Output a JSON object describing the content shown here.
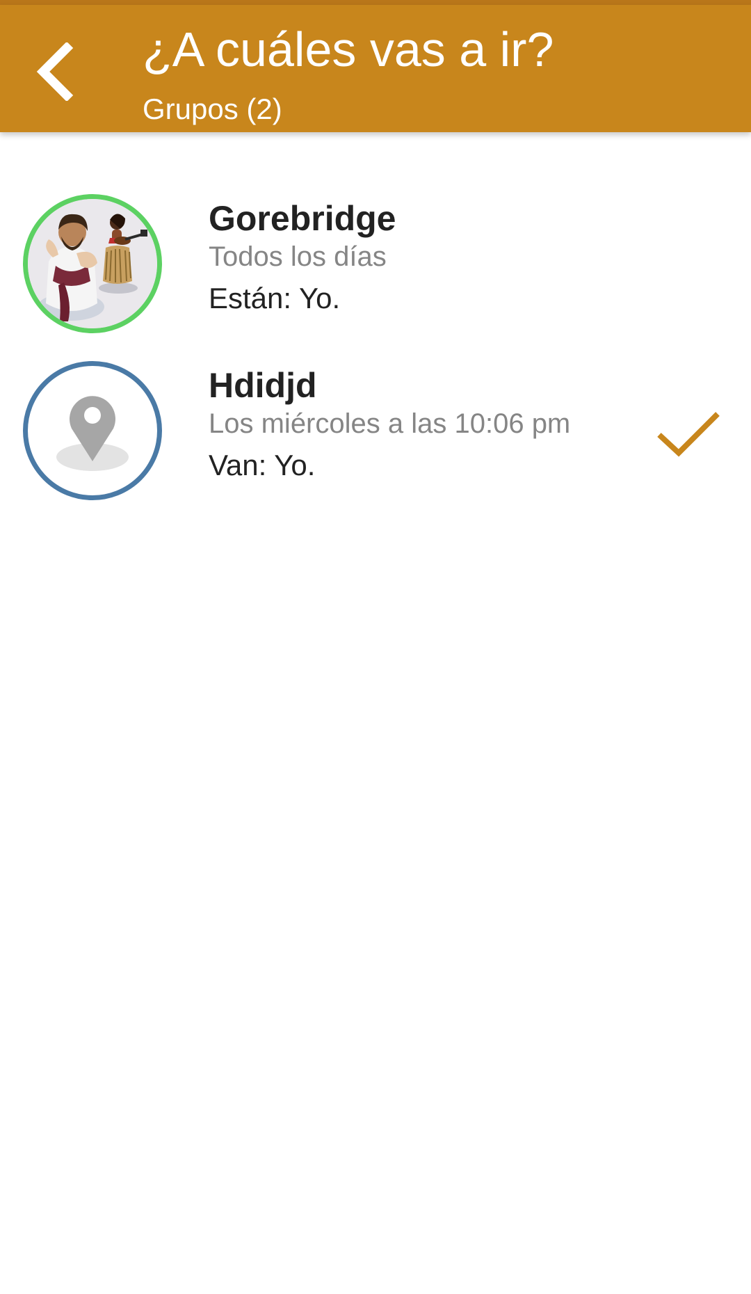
{
  "header": {
    "title": "¿A cuáles vas a ir?",
    "subtitle": "Grupos (2)",
    "back_icon": "chevron-left-icon",
    "background_color": "#c8861c"
  },
  "groups": [
    {
      "name": "Gorebridge",
      "schedule": "Todos los días",
      "attendees": "Están: Yo.",
      "avatar": "group-photo",
      "ring_color": "#5cd162",
      "attending": false
    },
    {
      "name": "Hdidjd",
      "schedule": "Los miércoles a las 10:06 pm",
      "attendees": "Van: Yo.",
      "avatar": "location-pin-icon",
      "ring_color": "#4a7aa6",
      "attending": true,
      "status_icon": "checkmark-icon",
      "status_color": "#c8861c"
    }
  ]
}
